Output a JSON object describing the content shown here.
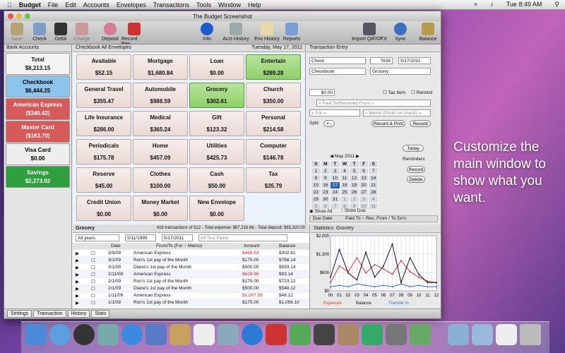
{
  "menubar": {
    "app": "Budget",
    "items": [
      "File",
      "Edit",
      "Accounts",
      "Envelopes",
      "Transactions",
      "Tools",
      "Window",
      "Help"
    ],
    "time": "Tue 8:49 AM"
  },
  "window": {
    "title": "The Budget Screenshot"
  },
  "toolbar": {
    "left": [
      "Save",
      "Check",
      "Debit",
      "Charge",
      "Deposit",
      "Record Pay"
    ],
    "center": [
      "Info",
      "Acct History",
      "Env History",
      "Reports"
    ],
    "right": [
      "Import QIF/OFX",
      "Sync",
      "Balance"
    ]
  },
  "sidebar": {
    "header": "Bank Accounts",
    "total_label": "Total",
    "total_value": "$8,213.15",
    "accounts": [
      {
        "name": "Checkbook",
        "value": "$6,444.25",
        "bg": "#8cc4ec",
        "color": "#000"
      },
      {
        "name": "American Express",
        "value": "($340.42)",
        "bg": "#d65a5a",
        "color": "#fff"
      },
      {
        "name": "Master Card",
        "value": "($163.70)",
        "bg": "#d65a5a",
        "color": "#fff"
      },
      {
        "name": "Visa Card",
        "value": "$0.00",
        "bg": "#eeeeee",
        "color": "#000"
      },
      {
        "name": "Savings",
        "value": "$2,273.02",
        "bg": "#2f9e3f",
        "color": "#fff"
      }
    ]
  },
  "checkbook": {
    "header": "Checkbook All Envelopes",
    "date": "Tuesday, May 17, 2011"
  },
  "envelopes": [
    {
      "name": "Available",
      "value": "$52.15"
    },
    {
      "name": "Mortgage",
      "value": "$1,680.84"
    },
    {
      "name": "Loan",
      "value": "$0.00"
    },
    {
      "name": "Entertain",
      "value": "$289.28"
    },
    {
      "name": "General Travel",
      "value": "$355.47"
    },
    {
      "name": "Automobile",
      "value": "$988.59"
    },
    {
      "name": "Grocery",
      "value": "$302.61"
    },
    {
      "name": "Church",
      "value": "$350.00"
    },
    {
      "name": "Life Insurance",
      "value": "$286.00"
    },
    {
      "name": "Medical",
      "value": "$365.24"
    },
    {
      "name": "Gift",
      "value": "$123.32"
    },
    {
      "name": "Personal",
      "value": "$214.58"
    },
    {
      "name": "Periodicals",
      "value": "$175.78"
    },
    {
      "name": "Home",
      "value": "$457.09"
    },
    {
      "name": "Utilities",
      "value": "$425.73"
    },
    {
      "name": "Computer",
      "value": "$146.78"
    },
    {
      "name": "Reserve",
      "value": "$45.00"
    },
    {
      "name": "Clothes",
      "value": "$100.00"
    },
    {
      "name": "Cash",
      "value": "$50.00"
    },
    {
      "name": "Tax",
      "value": "$35.79"
    },
    {
      "name": "Credit Union",
      "value": "$0.00"
    },
    {
      "name": "Money Market",
      "value": "$0.00"
    },
    {
      "name": "New Envelope",
      "value": "$0.00"
    }
  ],
  "entry": {
    "header": "Transaction Entry",
    "type": "Check",
    "number": "7836",
    "date": "5/17/2011",
    "account": "Checkbook",
    "envelope": "Grocery",
    "amount": "$0.00",
    "tax_item": "Tax Item",
    "remind": "Remind",
    "payee_placeholder": "« Paid To/Received From »",
    "for_placeholder": "« For »",
    "memo_placeholder": "« Memo (Prints on check) »",
    "split": "Split:",
    "record_print": "Record & Print",
    "record": "Record",
    "calendar_title": "May 2011",
    "today": "Today",
    "reminders": "Reminders",
    "r_record": "Record",
    "r_delete": "Delete",
    "show_all": "Show All",
    "show_due": "Show Due",
    "due_date": "Due Date",
    "paid_to": "Paid To ~ Rec. From / To Do's"
  },
  "calendar": {
    "days": [
      "S",
      "M",
      "T",
      "W",
      "T",
      "F",
      "S"
    ],
    "weeks": [
      [
        "1",
        "2",
        "3",
        "4",
        "5",
        "6",
        "7"
      ],
      [
        "8",
        "9",
        "10",
        "11",
        "12",
        "13",
        "14"
      ],
      [
        "15",
        "16",
        "17",
        "18",
        "19",
        "20",
        "21"
      ],
      [
        "22",
        "23",
        "24",
        "25",
        "26",
        "27",
        "28"
      ],
      [
        "29",
        "30",
        "31",
        "1",
        "2",
        "3",
        "4"
      ],
      [
        "5",
        "6",
        "7",
        "8",
        "9",
        "10",
        "11"
      ]
    ]
  },
  "register": {
    "title": "Grocery",
    "summary": "418 transactions of 512 - Total expense: $67,216.66 - Total deposit: $65,320.00",
    "filter": "All years",
    "from": "5/11/1999",
    "to": "5/17/2011",
    "search": "All Text Fields",
    "columns": [
      "Date",
      "From/To (For ~ Memo)",
      "Amount",
      "Balance"
    ],
    "rows": [
      {
        "date": "3/9/09",
        "payee": "American Express",
        "amount": "$465.53",
        "balance": "$302.61",
        "neg": true
      },
      {
        "date": "3/1/09",
        "payee": "Ron's 1st pay of the Month",
        "amount": "$175.00",
        "balance": "$768.14",
        "neg": false
      },
      {
        "date": "3/1/09",
        "payee": "Diane's 1st pay of the Month",
        "amount": "$500.00",
        "balance": "$593.14",
        "neg": false
      },
      {
        "date": "2/11/09",
        "payee": "American Express",
        "amount": "$629.98",
        "balance": "$93.14",
        "neg": true
      },
      {
        "date": "2/1/09",
        "payee": "Ron's 1st pay of the Month",
        "amount": "$175.00",
        "balance": "$723.12",
        "neg": false
      },
      {
        "date": "2/1/09",
        "payee": "Diane's 1st pay of the Month",
        "amount": "$500.00",
        "balance": "$548.12",
        "neg": false
      },
      {
        "date": "1/11/09",
        "payee": "American Express",
        "amount": "$1,007.58",
        "balance": "$48.12",
        "neg": true
      },
      {
        "date": "1/1/09",
        "payee": "Ron's 1st pay of the Month",
        "amount": "$175.00",
        "balance": "$1,056.10",
        "neg": false
      }
    ]
  },
  "stats": {
    "header": "Statistics: Grocery",
    "legend": [
      "Expenses",
      "Balance",
      "Transfer In"
    ]
  },
  "statusbar": [
    "Settings",
    "Transaction",
    "History",
    "Stats"
  ],
  "promo": "Customize the main window to show what you want.",
  "chart_data": {
    "type": "line",
    "title": "Statistics: Grocery",
    "x": [
      0,
      1,
      2,
      3,
      4,
      5,
      6,
      7,
      8,
      9,
      10,
      11,
      12
    ],
    "xticks": [
      "00",
      "01",
      "02",
      "03",
      "04",
      "05",
      "06",
      "07",
      "08",
      "09",
      "10",
      "11",
      "12"
    ],
    "ylim": [
      0,
      2000
    ],
    "yticks": [
      "$0",
      "$600",
      "$1,300",
      "$2,000"
    ],
    "series": [
      {
        "name": "Expenses",
        "color": "#e03030",
        "values": [
          300,
          900,
          700,
          1200,
          650,
          950,
          800,
          600,
          1100,
          700,
          500,
          350,
          300
        ]
      },
      {
        "name": "Balance",
        "color": "#111111",
        "values": [
          500,
          1500,
          650,
          400,
          1400,
          500,
          900,
          1700,
          300,
          1200,
          600,
          300,
          300
        ]
      },
      {
        "name": "Transfer In",
        "color": "#2a6fd0",
        "values": [
          150,
          200,
          150,
          250,
          200,
          150,
          200,
          150,
          250,
          150,
          200,
          150,
          150
        ]
      }
    ]
  }
}
